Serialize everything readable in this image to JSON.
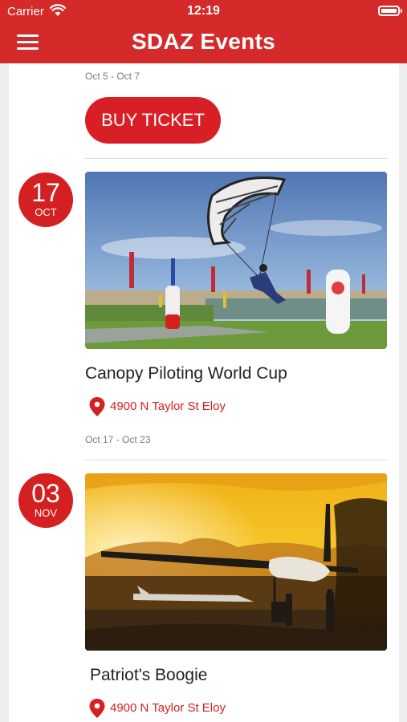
{
  "status_bar": {
    "carrier": "Carrier",
    "time": "12:19"
  },
  "header": {
    "title": "SDAZ Events"
  },
  "events": [
    {
      "date_range": "Oct 5 - Oct 7",
      "buy_label": "BUY TICKET"
    },
    {
      "day": "17",
      "month": "OCT",
      "image": "canopy-piloting-photo",
      "title": "Canopy Piloting World Cup",
      "location": "4900 N Taylor St Eloy",
      "date_range": "Oct 17 - Oct 23"
    },
    {
      "day": "03",
      "month": "NOV",
      "image": "airplane-sunset-photo",
      "title": "Patriot's Boogie",
      "location": "4900 N Taylor St Eloy"
    }
  ],
  "icons": {
    "menu": "hamburger-menu-icon",
    "location": "map-pin-icon",
    "wifi": "wifi-icon",
    "battery": "battery-icon"
  },
  "colors": {
    "brand_red": "#d42a2a",
    "button_red": "#d81f26",
    "location_red": "#d42020"
  }
}
